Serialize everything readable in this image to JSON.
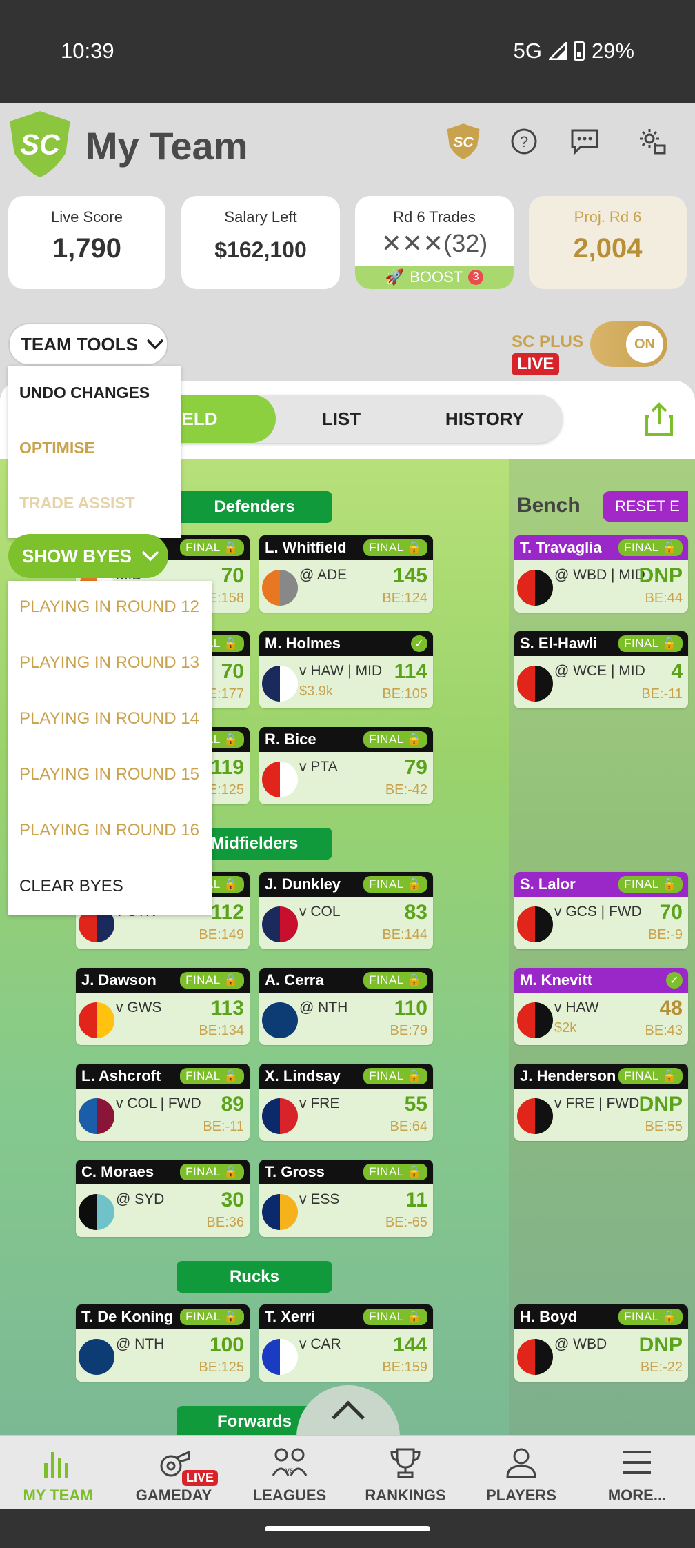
{
  "status": {
    "time": "10:39",
    "network": "5G",
    "battery": "29%"
  },
  "app": {
    "title": "My Team"
  },
  "stats": {
    "live_score_label": "Live Score",
    "live_score": "1,790",
    "salary_label": "Salary Left",
    "salary": "$162,100",
    "trades_label": "Rd 6 Trades",
    "trades": "✕✕✕(32)",
    "boost_label": "BOOST",
    "boost_count": "3",
    "proj_label": "Proj. Rd 6",
    "proj": "2,004"
  },
  "tools": {
    "team_tools": "TEAM TOOLS",
    "sc_plus": "SC PLUS",
    "live": "LIVE",
    "toggle": "ON"
  },
  "tabs": [
    "FIELD",
    "LIST",
    "HISTORY"
  ],
  "team_tools_menu": [
    "UNDO CHANGES",
    "OPTIMISE",
    "TRADE ASSIST"
  ],
  "show_byes": "SHOW BYES",
  "byes_menu": [
    "PLAYING IN ROUND 12",
    "PLAYING IN ROUND 13",
    "PLAYING IN ROUND 14",
    "PLAYING IN ROUND 15",
    "PLAYING IN ROUND 16",
    "CLEAR BYES"
  ],
  "sections": {
    "defenders": "Defenders",
    "midfielders": "Midfielders",
    "rucks": "Rucks",
    "forwards": "Forwards",
    "bench": "Bench",
    "reset": "RESET E"
  },
  "final_label": "FINAL",
  "players": [
    {
      "name": "",
      "opp": "MID",
      "score": "70",
      "be": "E:158",
      "colors": [
        "#e87722",
        "#ffffff"
      ]
    },
    {
      "name": "L. Whitfield",
      "opp": "@ ADE",
      "score": "145",
      "be": "BE:124",
      "colors": [
        "#e87722",
        "#888888"
      ]
    },
    {
      "name": "",
      "opp": "",
      "score": "70",
      "be": "E:177",
      "colors": [
        "#ffffff",
        "#ffffff"
      ]
    },
    {
      "name": "M. Holmes",
      "opp": "v HAW | MID",
      "price": "$3.9k",
      "score": "114",
      "be": "BE:105",
      "colors": [
        "#1a2a5c",
        "#ffffff"
      ]
    },
    {
      "name": "",
      "opp": "",
      "score": "119",
      "be": "E:125",
      "colors": [
        "#ffffff",
        "#ffffff"
      ]
    },
    {
      "name": "R. Bice",
      "opp": "v PTA",
      "score": "79",
      "be": "BE:-42",
      "colors": [
        "#e1251b",
        "#ffffff"
      ]
    },
    {
      "name": "",
      "opp": "v STK",
      "score": "112",
      "be": "BE:149",
      "colors": [
        "#e1251b",
        "#1a2a5c"
      ]
    },
    {
      "name": "J. Dunkley",
      "opp": "v COL",
      "score": "83",
      "be": "BE:144",
      "colors": [
        "#1a2a5c",
        "#c8102e"
      ]
    },
    {
      "name": "J. Dawson",
      "opp": "v GWS",
      "score": "113",
      "be": "BE:134",
      "colors": [
        "#e1251b",
        "#ffc20e"
      ]
    },
    {
      "name": "A. Cerra",
      "opp": "@ NTH",
      "score": "110",
      "be": "BE:79",
      "colors": [
        "#0d3c74",
        "#0d3c74"
      ]
    },
    {
      "name": "L. Ashcroft",
      "opp": "v COL | FWD",
      "score": "89",
      "be": "BE:-11",
      "colors": [
        "#1a5da8",
        "#8a1538"
      ]
    },
    {
      "name": "X. Lindsay",
      "opp": "v FRE",
      "score": "55",
      "be": "BE:64",
      "colors": [
        "#0b2a6b",
        "#d8232a"
      ]
    },
    {
      "name": "C. Moraes",
      "opp": "@ SYD",
      "score": "30",
      "be": "BE:36",
      "colors": [
        "#0d0d0d",
        "#6fc2c7"
      ]
    },
    {
      "name": "T. Gross",
      "opp": "v ESS",
      "score": "11",
      "be": "BE:-65",
      "colors": [
        "#0b2a6b",
        "#f6b21b"
      ]
    },
    {
      "name": "T. De Koning",
      "opp": "@ NTH",
      "score": "100",
      "be": "BE:125",
      "colors": [
        "#0d3c74",
        "#0d3c74"
      ]
    },
    {
      "name": "T. Xerri",
      "opp": "v CAR",
      "score": "144",
      "be": "BE:159",
      "colors": [
        "#1a3cc2",
        "#ffffff"
      ]
    }
  ],
  "bench_players": [
    {
      "name": "T. Travaglia",
      "opp": "@ WBD | MID",
      "score": "DNP",
      "be": "BE:44"
    },
    {
      "name": "S. El-Hawli",
      "opp": "@ WCE | MID",
      "score": "4",
      "be": "BE:-11"
    },
    {
      "name": "S. Lalor",
      "opp": "v GCS | FWD",
      "score": "70",
      "be": "BE:-9"
    },
    {
      "name": "M. Knevitt",
      "opp": "v HAW",
      "price": "$2k",
      "score": "48",
      "be": "BE:43"
    },
    {
      "name": "J. Henderson",
      "opp": "v FRE | FWD",
      "score": "DNP",
      "be": "BE:55"
    },
    {
      "name": "H. Boyd",
      "opp": "@ WBD",
      "score": "DNP",
      "be": "BE:-22"
    }
  ],
  "nav": [
    "MY TEAM",
    "GAMEDAY",
    "LEAGUES",
    "RANKINGS",
    "PLAYERS",
    "MORE..."
  ],
  "nav_live": "LIVE",
  "colors": {
    "accent_green": "#7cbf2b",
    "gold": "#c9a24d",
    "purple": "#9a27c8",
    "live_red": "#d8232a"
  }
}
